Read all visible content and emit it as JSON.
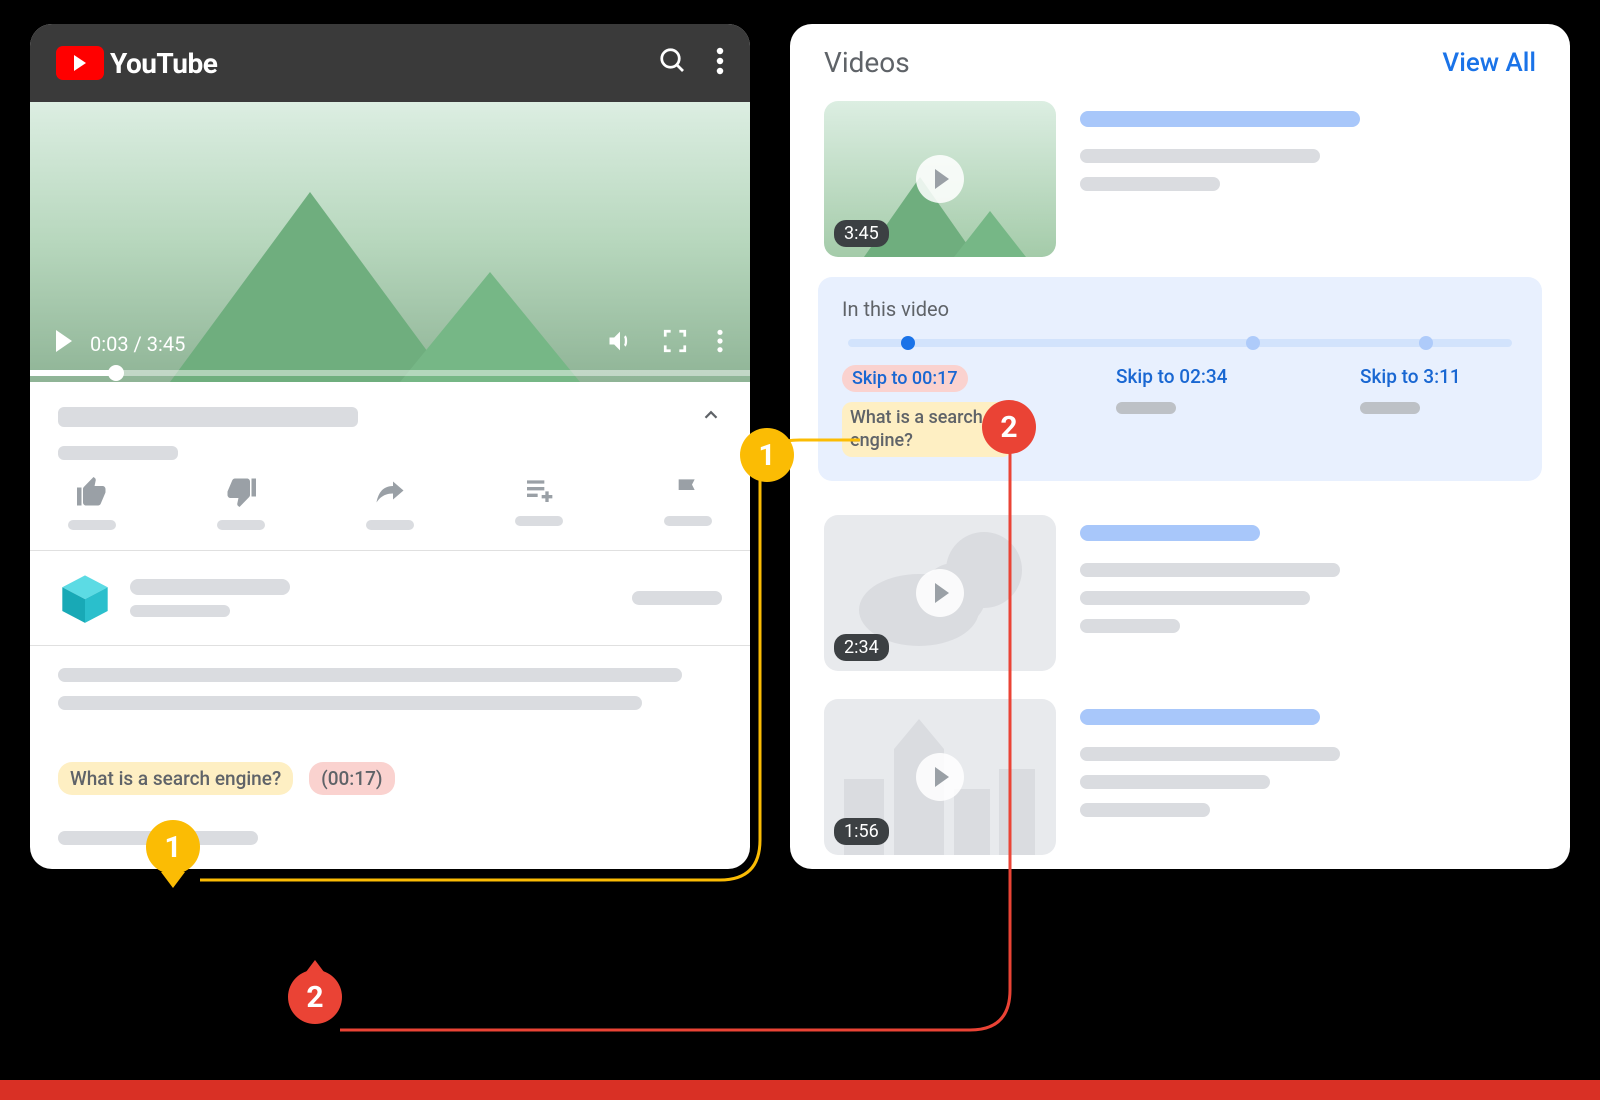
{
  "youtube": {
    "brand": "YouTube",
    "current_time": "0:03",
    "duration": "3:45",
    "time_display": "0:03 / 3:45"
  },
  "annotation": {
    "title_text": "What is a search engine?",
    "timestamp_text": "(00:17)",
    "callout_1": "1",
    "callout_2": "2"
  },
  "search": {
    "section_title": "Videos",
    "view_all": "View All",
    "results": [
      {
        "duration": "3:45"
      },
      {
        "duration": "2:34"
      },
      {
        "duration": "1:56"
      }
    ],
    "key_moments": {
      "heading": "In this video",
      "items": [
        {
          "skip": "Skip to 00:17",
          "label": "What is a search engine?"
        },
        {
          "skip": "Skip to 02:34"
        },
        {
          "skip": "Skip to 3:11"
        }
      ]
    }
  },
  "colors": {
    "yellow": "#FBBC04",
    "red": "#EA4335",
    "blue": "#1A73E8"
  }
}
